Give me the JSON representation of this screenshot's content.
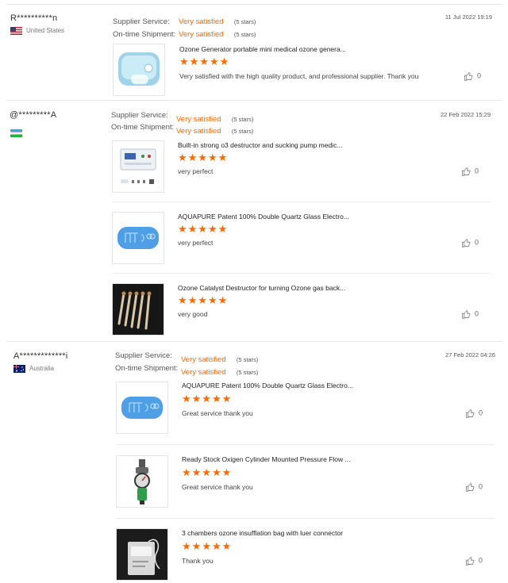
{
  "reviews": [
    {
      "name": "R**********n",
      "country": "United States",
      "supplier_label": "Supplier Service:",
      "supplier_value": "Very satisfied",
      "supplier_stars": "(5 stars)",
      "shipment_label": "On-time Shipment:",
      "shipment_value": "Very satisfied",
      "shipment_stars": "(5 stars)",
      "date": "11 Jul 2022 19:19",
      "items": [
        {
          "title": "Ozone Generator portable mini medical ozone genera...",
          "stars": "★★★★★",
          "comment": "Very satisfied with the high quality product, and professional supplier. Thank you",
          "likes": "0"
        }
      ]
    },
    {
      "name": "@*********A",
      "country": "",
      "supplier_label": "Supplier Service:",
      "supplier_value": "Very satisfied",
      "supplier_stars": "(5 stars)",
      "shipment_label": "On-time Shipment:",
      "shipment_value": "Very satisfied",
      "shipment_stars": "(5 stars)",
      "date": "22 Feb 2022 15:29",
      "items": [
        {
          "title": "Built-in strong o3 destructor and sucking pump medic...",
          "stars": "★★★★★",
          "comment": "very perfect",
          "likes": "0"
        },
        {
          "title": "AQUAPURE Patent 100% Double Quartz Glass Electro...",
          "stars": "★★★★★",
          "comment": "very perfect",
          "likes": "0"
        },
        {
          "title": "Ozone Catalyst Destructor for turning Ozone gas back...",
          "stars": "★★★★★",
          "comment": "very good",
          "likes": "0"
        }
      ]
    },
    {
      "name": "A*************i",
      "country": "Australia",
      "supplier_label": "Supplier Service:",
      "supplier_value": "Very satisfied",
      "supplier_stars": "(5 stars)",
      "shipment_label": "On-time Shipment:",
      "shipment_value": "Very satisfied",
      "shipment_stars": "(5 stars)",
      "date": "27 Feb 2022 04:26",
      "items": [
        {
          "title": "AQUAPURE Patent 100% Double Quartz Glass Electro...",
          "stars": "★★★★★",
          "comment": "Great service thank you",
          "likes": "0"
        },
        {
          "title": "Ready Stock Oxigen Cylinder Mounted Pressure Flow ...",
          "stars": "★★★★★",
          "comment": "Great service thank you",
          "likes": "0"
        },
        {
          "title": "3 chambers ozone insufflation bag with luer connector",
          "stars": "★★★★★",
          "comment": "Thank you",
          "likes": "0"
        }
      ]
    }
  ],
  "icons": {
    "flag_us": "us-flag-icon",
    "flag_uz": "uzbekistan-flag-icon",
    "flag_au": "australia-flag-icon",
    "like": "thumbs-up-icon"
  },
  "colors": {
    "accent": "#ff6a00"
  }
}
